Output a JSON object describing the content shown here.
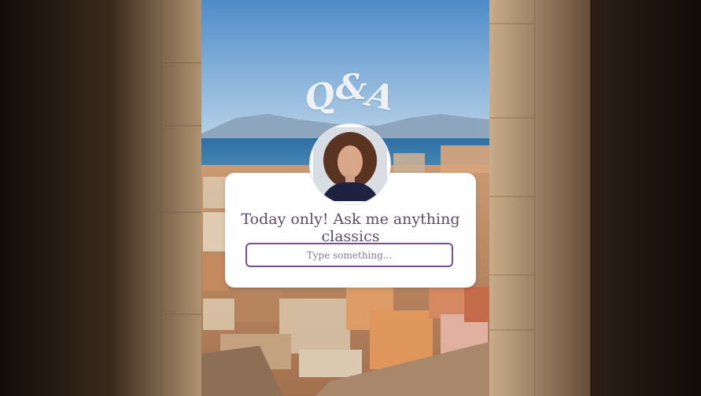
{
  "header": {
    "title_q": "Q",
    "title_amp": "&",
    "title_a": "A"
  },
  "card": {
    "prompt": "Today only! Ask me anything classics",
    "input_placeholder": "Type something..."
  },
  "colors": {
    "sky": "#7fb0de",
    "sea": "#2f6d9c",
    "stone": "#8b7358",
    "accent": "#7b4f96",
    "text": "#5a4a66"
  }
}
